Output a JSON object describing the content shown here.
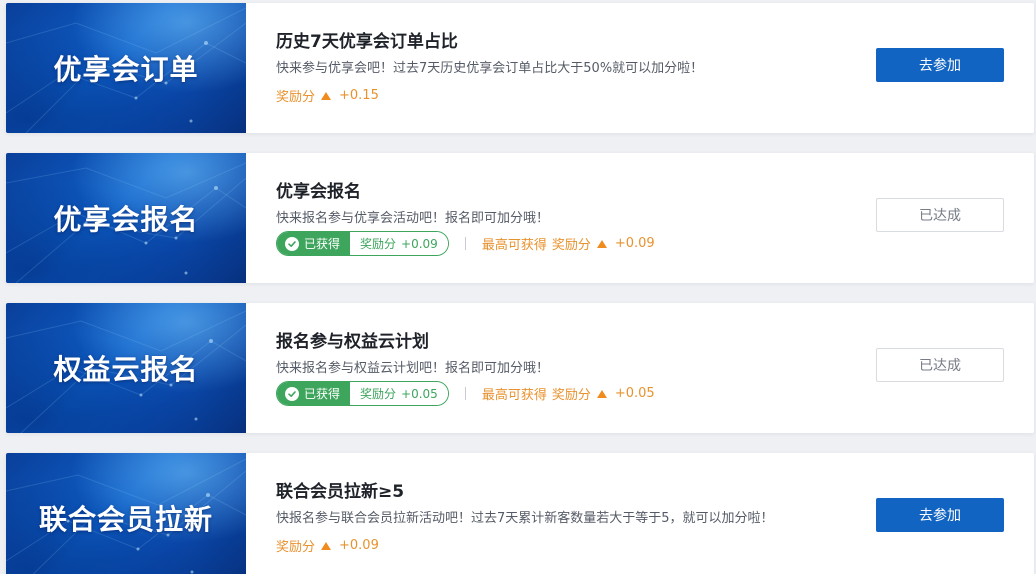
{
  "cards": [
    {
      "banner": "优享会订单",
      "title": "历史7天优享会订单占比",
      "desc": "快来参与优享会吧！过去7天历史优享会订单占比大于50%就可以加分啦！",
      "reward_label": "奖励分",
      "reward_value": "+0.15",
      "button": "去参加"
    },
    {
      "banner": "优享会报名",
      "title": "优享会报名",
      "desc": "快来报名参与优享会活动吧！报名即可加分哦！",
      "obtained_label": "已获得",
      "obtained_reward_label": "奖励分",
      "obtained_value": "+0.09",
      "max_label": "最高可获得",
      "max_reward_label": "奖励分",
      "max_value": "+0.09",
      "button": "已达成"
    },
    {
      "banner": "权益云报名",
      "title": "报名参与权益云计划",
      "desc": "快来报名参与权益云计划吧！报名即可加分哦！",
      "obtained_label": "已获得",
      "obtained_reward_label": "奖励分",
      "obtained_value": "+0.05",
      "max_label": "最高可获得",
      "max_reward_label": "奖励分",
      "max_value": "+0.05",
      "button": "已达成"
    },
    {
      "banner": "联合会员拉新",
      "title": "联合会员拉新≥5",
      "desc": "快报名参与联合会员拉新活动吧！过去7天累计新客数量若大于等于5，就可以加分啦！",
      "reward_label": "奖励分",
      "reward_value": "+0.09",
      "button": "去参加"
    }
  ],
  "colors": {
    "primary": "#1164c2",
    "reward": "#e8922e",
    "success": "#3ea55d"
  }
}
